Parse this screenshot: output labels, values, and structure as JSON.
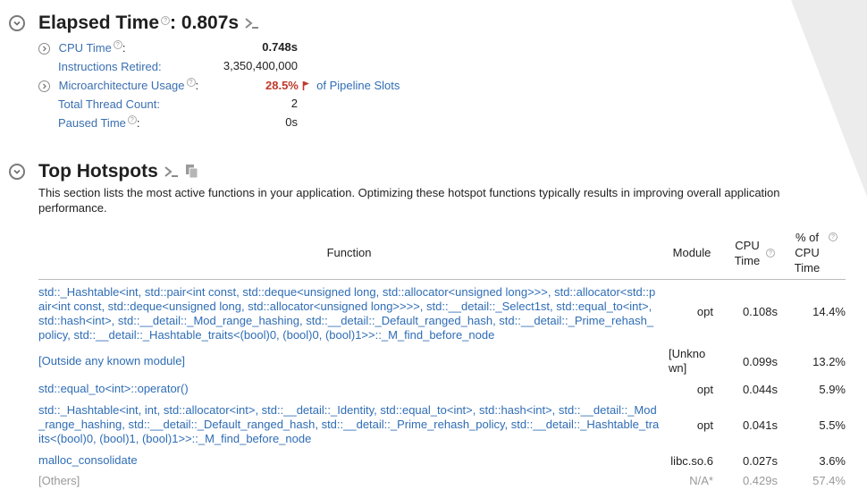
{
  "elapsed": {
    "title": "Elapsed Time",
    "colon_value": ": 0.807s",
    "metrics": [
      {
        "label": "CPU Time",
        "suffix": ":",
        "value": "0.748s",
        "expandable": true,
        "help": true
      },
      {
        "label": "Instructions Retired:",
        "value": "3,350,400,000"
      },
      {
        "label": "Microarchitecture Usage",
        "suffix": ":",
        "value": "28.5%",
        "extra": "of Pipeline Slots",
        "expandable": true,
        "help": true
      },
      {
        "label": "Total Thread Count:",
        "value": "2"
      },
      {
        "label": "Paused Time",
        "suffix": ":",
        "value": "0s",
        "help": true
      }
    ]
  },
  "hotspots": {
    "title": "Top Hotspots",
    "description": "This section lists the most active functions in your application. Optimizing these hotspot functions typically results in improving overall application performance.",
    "columns": {
      "function": "Function",
      "module": "Module",
      "cpu_time": "CPU Time",
      "pct": "% of CPU Time"
    },
    "rows": [
      {
        "function": "std::_Hashtable<int, std::pair<int const, std::deque<unsigned long, std::allocator<unsigned long>>>, std::allocator<std::pair<int const, std::deque<unsigned long, std::allocator<unsigned long>>>>, std::__detail::_Select1st, std::equal_to<int>, std::hash<int>, std::__detail::_Mod_range_hashing, std::__detail::_Default_ranged_hash, std::__detail::_Prime_rehash_policy, std::__detail::_Hashtable_traits<(bool)0, (bool)0, (bool)1>>::_M_find_before_node",
        "module": "opt",
        "cpu_time": "0.108s",
        "pct": "14.4%"
      },
      {
        "function": "[Outside any known module]",
        "module": "[Unknown]",
        "cpu_time": "0.099s",
        "pct": "13.2%"
      },
      {
        "function": "std::equal_to<int>::operator()",
        "module": "opt",
        "cpu_time": "0.044s",
        "pct": "5.9%"
      },
      {
        "function": "std::_Hashtable<int, int, std::allocator<int>, std::__detail::_Identity, std::equal_to<int>, std::hash<int>, std::__detail::_Mod_range_hashing, std::__detail::_Default_ranged_hash, std::__detail::_Prime_rehash_policy, std::__detail::_Hashtable_traits<(bool)0, (bool)1, (bool)1>>::_M_find_before_node",
        "module": "opt",
        "cpu_time": "0.041s",
        "pct": "5.5%"
      },
      {
        "function": "malloc_consolidate",
        "module": "libc.so.6",
        "cpu_time": "0.027s",
        "pct": "3.6%"
      },
      {
        "function": "[Others]",
        "module": "N/A*",
        "cpu_time": "0.429s",
        "pct": "57.4%"
      }
    ]
  },
  "colors": {
    "link": "#2f6db5",
    "warning": "#c0392b"
  }
}
